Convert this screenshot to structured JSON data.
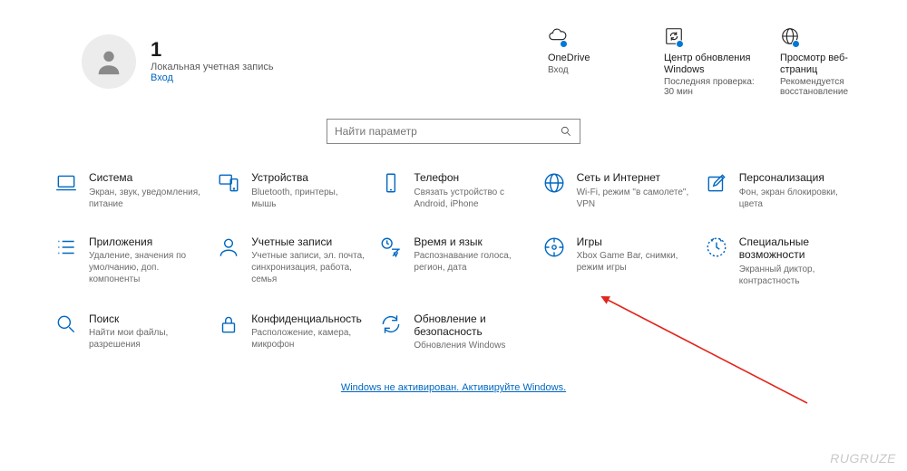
{
  "user": {
    "name": "1",
    "desc": "Локальная учетная запись",
    "link": "Вход"
  },
  "tiles": [
    {
      "id": "onedrive",
      "icon": "cloud",
      "title": "OneDrive",
      "desc": "Вход"
    },
    {
      "id": "update",
      "icon": "refresh-box",
      "title": "Центр обновления Windows",
      "desc": "Последняя проверка: 30 мин"
    },
    {
      "id": "browse",
      "icon": "globe",
      "title": "Просмотр веб-страниц",
      "desc": "Рекомендуется восстановление"
    }
  ],
  "search": {
    "placeholder": "Найти параметр"
  },
  "categories": [
    {
      "id": "system",
      "icon": "laptop",
      "title": "Система",
      "desc": "Экран, звук, уведомления, питание"
    },
    {
      "id": "devices",
      "icon": "devices",
      "title": "Устройства",
      "desc": "Bluetooth, принтеры, мышь"
    },
    {
      "id": "phone",
      "icon": "phone",
      "title": "Телефон",
      "desc": "Связать устройство с Android, iPhone"
    },
    {
      "id": "network",
      "icon": "globe",
      "title": "Сеть и Интернет",
      "desc": "Wi-Fi, режим \"в самолете\", VPN"
    },
    {
      "id": "personalization",
      "icon": "pen-box",
      "title": "Персонализация",
      "desc": "Фон, экран блокировки, цвета"
    },
    {
      "id": "apps",
      "icon": "list",
      "title": "Приложения",
      "desc": "Удаление, значения по умолчанию, доп. компоненты"
    },
    {
      "id": "accounts",
      "icon": "person",
      "title": "Учетные записи",
      "desc": "Учетные записи, эл. почта, синхронизация, работа, семья"
    },
    {
      "id": "time",
      "icon": "time-lang",
      "title": "Время и язык",
      "desc": "Распознавание голоса, регион, дата"
    },
    {
      "id": "gaming",
      "icon": "gaming",
      "title": "Игры",
      "desc": "Xbox Game Bar, снимки, режим игры"
    },
    {
      "id": "accessibility",
      "icon": "access",
      "title": "Специальные возможности",
      "desc": "Экранный диктор, контрастность"
    },
    {
      "id": "search-cat",
      "icon": "search",
      "title": "Поиск",
      "desc": "Найти мои файлы, разрешения"
    },
    {
      "id": "privacy",
      "icon": "lock",
      "title": "Конфиденциальность",
      "desc": "Расположение, камера, микрофон"
    },
    {
      "id": "update-sec",
      "icon": "sync",
      "title": "Обновление и безопасность",
      "desc": "Обновления Windows"
    }
  ],
  "activation": {
    "text1": "Windows не активирован.",
    "text2": "Активируйте Windows."
  },
  "watermark": "RUGRUZE"
}
